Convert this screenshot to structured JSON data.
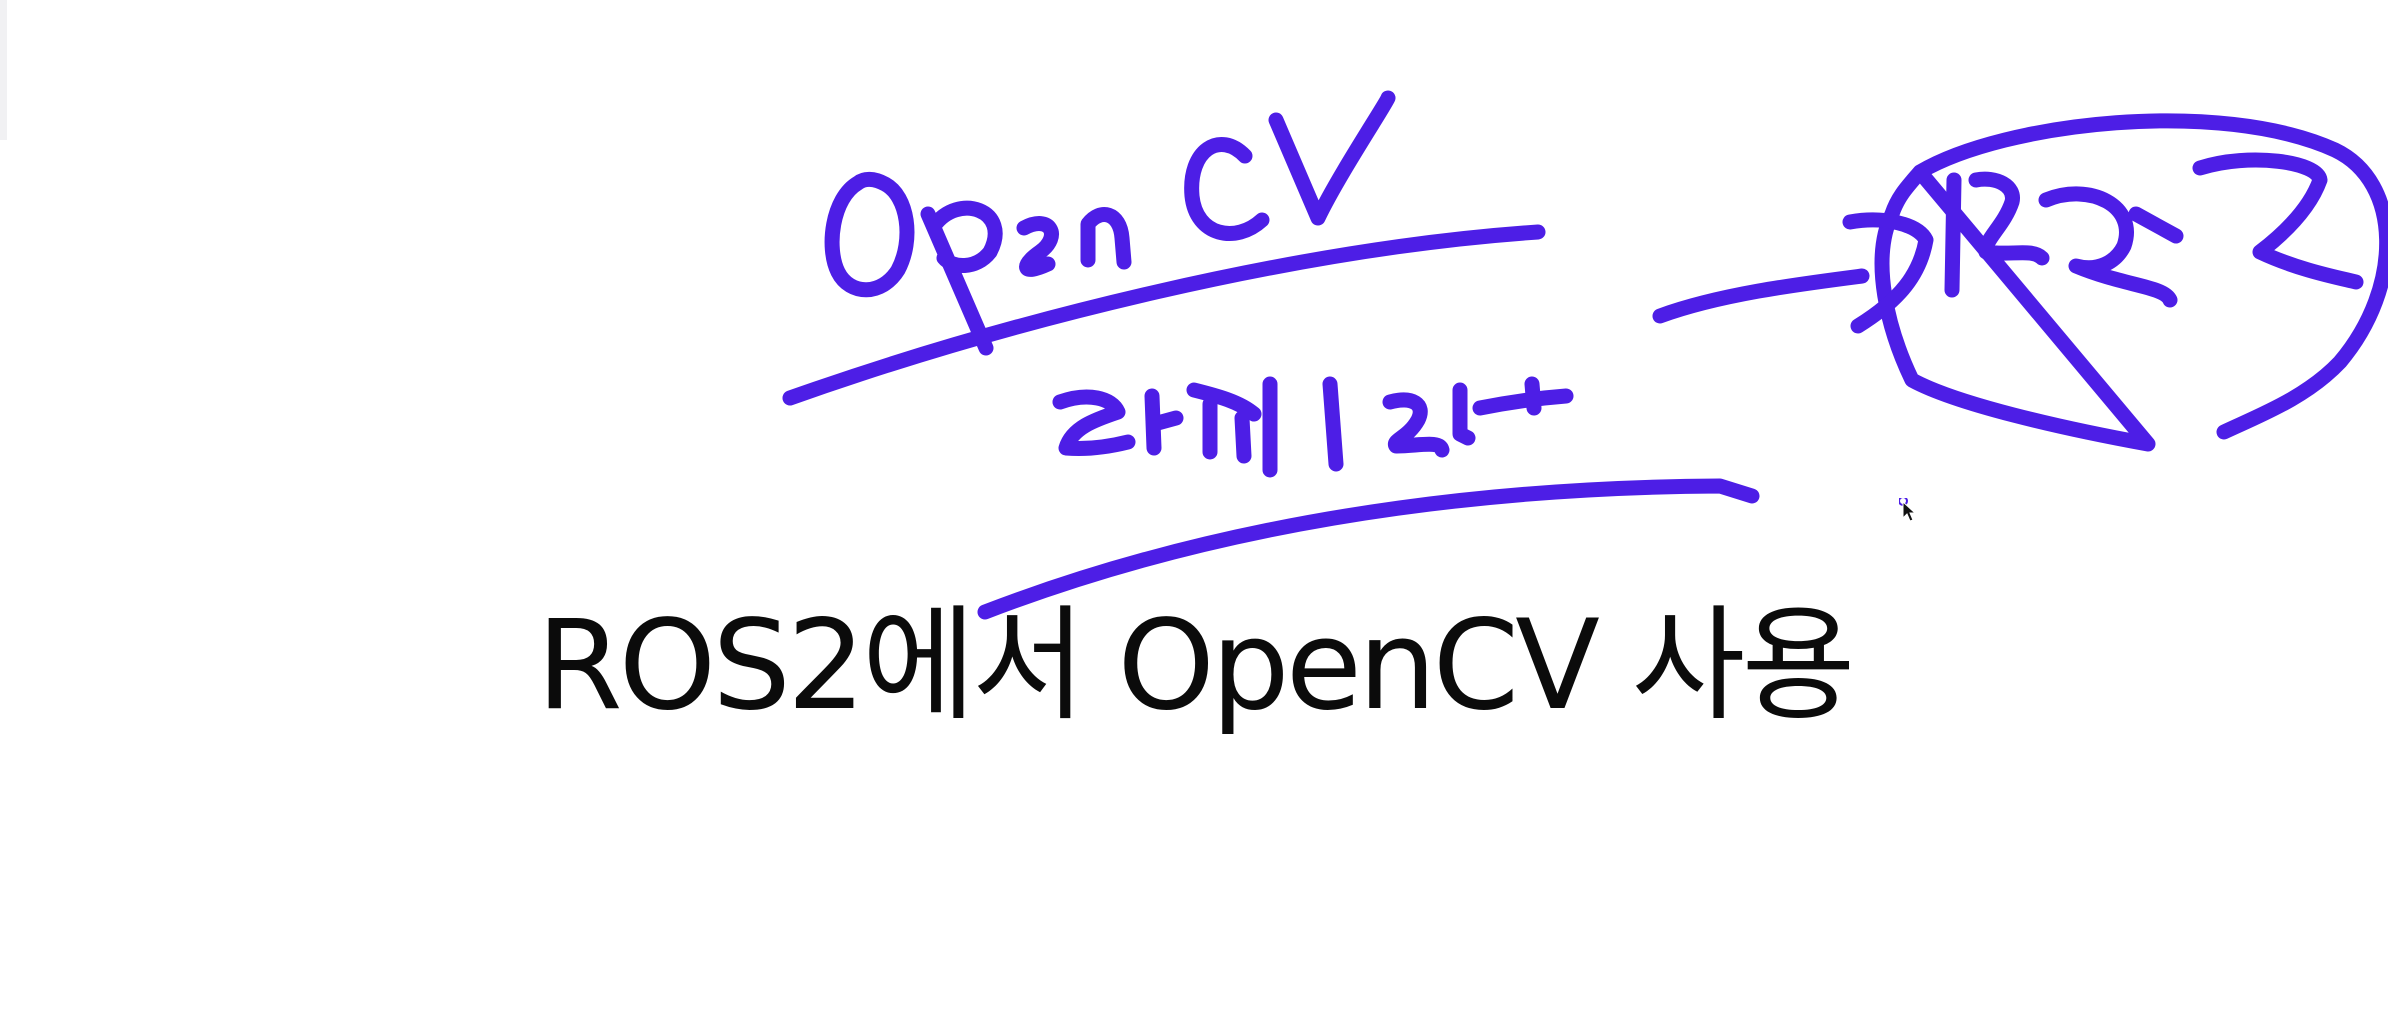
{
  "slide": {
    "title": "ROS2에서 OpenCV 사용",
    "ink_color": "#4d1ee6"
  }
}
